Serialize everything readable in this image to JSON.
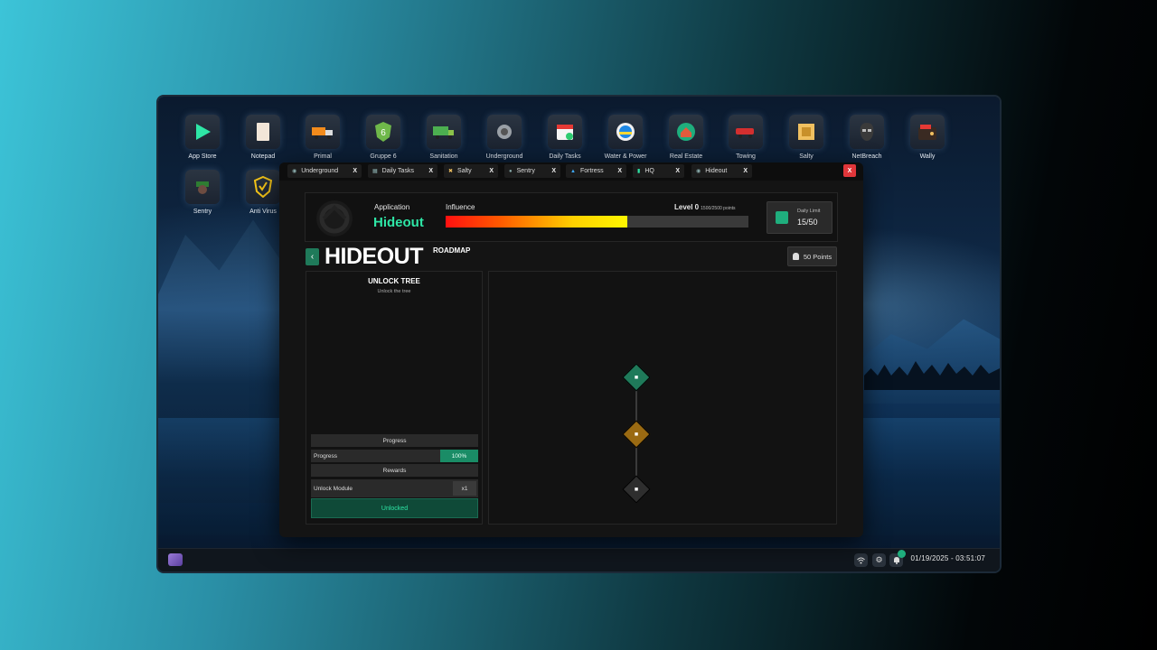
{
  "desktop": {
    "icons": [
      {
        "label": "App Store",
        "icon": "play-store-icon"
      },
      {
        "label": "Notepad",
        "icon": "notepad-icon"
      },
      {
        "label": "Primal",
        "icon": "truck-icon"
      },
      {
        "label": "Gruppe 6",
        "icon": "gruppe6-shield-icon"
      },
      {
        "label": "Sanitation",
        "icon": "garbage-truck-icon"
      },
      {
        "label": "Underground",
        "icon": "turbo-icon"
      },
      {
        "label": "Daily Tasks",
        "icon": "calendar-check-icon"
      },
      {
        "label": "Water & Power",
        "icon": "water-power-badge-icon"
      },
      {
        "label": "Real Estate",
        "icon": "house-circle-icon"
      },
      {
        "label": "Towing",
        "icon": "tow-truck-icon"
      },
      {
        "label": "Salty",
        "icon": "salty-icon"
      },
      {
        "label": "NetBreach",
        "icon": "netbreach-mask-icon"
      },
      {
        "label": "Wally",
        "icon": "wallet-icon"
      },
      {
        "label": "Sentry",
        "icon": "sentry-icon"
      },
      {
        "label": "Anti Virus",
        "icon": "antivirus-shield-icon"
      }
    ]
  },
  "taskbar": {
    "clock": "01/19/2025 - 03:51:07",
    "notification_count": ""
  },
  "app": {
    "tabs": [
      {
        "label": "Underground",
        "close": "X"
      },
      {
        "label": "Daily Tasks",
        "close": "X"
      },
      {
        "label": "Salty",
        "close": "X"
      },
      {
        "label": "Sentry",
        "close": "X"
      },
      {
        "label": "Fortress",
        "close": "X"
      },
      {
        "label": "HQ",
        "close": "X"
      },
      {
        "label": "Hideout",
        "close": "X"
      }
    ],
    "close_label": "X",
    "header": {
      "application_label": "Application",
      "application_name": "Hideout",
      "influence_label": "Influence",
      "level_label": "Level 0",
      "level_points": "1500/2500 points",
      "influence_fraction": 0.6,
      "daily_limit_label": "Daily Limit",
      "daily_limit_value": "15/50"
    },
    "page": {
      "title": "HIDEOUT",
      "subtitle": "ROADMAP",
      "points": "50 Points"
    },
    "unlock_panel": {
      "title": "UNLOCK TREE",
      "description": "Unlock the tree",
      "progress_header": "Progress",
      "progress_label": "Progress",
      "progress_value": "100%",
      "rewards_header": "Rewards",
      "reward_label": "Unlock Module",
      "reward_qty": "x1",
      "status_button": "Unlocked"
    },
    "roadmap_nodes": [
      {
        "state": "unlocked",
        "color": "#1f7a5a"
      },
      {
        "state": "available",
        "color": "#9a6a12"
      },
      {
        "state": "locked",
        "color": "#2e2e2e"
      }
    ]
  },
  "colors": {
    "accent": "#2ee6a6",
    "close_red": "#e0363a"
  }
}
